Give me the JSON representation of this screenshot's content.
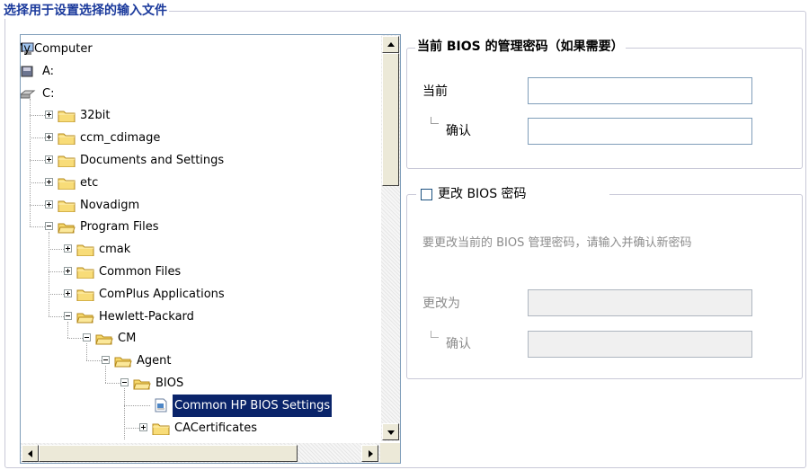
{
  "outer_group": {
    "title": "选择用于设置选择的输入文件"
  },
  "tree": {
    "items": [
      {
        "label": "My Computer",
        "icon": "computer-icon"
      },
      {
        "label": "A:",
        "icon": "floppy-drive-icon"
      },
      {
        "label": "C:",
        "icon": "hard-drive-icon"
      },
      {
        "label": "32bit",
        "icon": "folder-icon",
        "expander": "plus"
      },
      {
        "label": "ccm_cdimage",
        "icon": "folder-icon",
        "expander": "plus"
      },
      {
        "label": "Documents and Settings",
        "icon": "folder-icon",
        "expander": "plus"
      },
      {
        "label": "etc",
        "icon": "folder-icon",
        "expander": "plus"
      },
      {
        "label": "Novadigm",
        "icon": "folder-icon",
        "expander": "plus"
      },
      {
        "label": "Program Files",
        "icon": "folder-open-icon",
        "expander": "minus"
      },
      {
        "label": "cmak",
        "icon": "folder-icon",
        "expander": "plus"
      },
      {
        "label": "Common Files",
        "icon": "folder-icon",
        "expander": "plus"
      },
      {
        "label": "ComPlus Applications",
        "icon": "folder-icon",
        "expander": "plus"
      },
      {
        "label": "Hewlett-Packard",
        "icon": "folder-open-icon",
        "expander": "minus"
      },
      {
        "label": "CM",
        "icon": "folder-open-icon",
        "expander": "minus"
      },
      {
        "label": "Agent",
        "icon": "folder-open-icon",
        "expander": "minus"
      },
      {
        "label": "BIOS",
        "icon": "folder-open-icon",
        "expander": "minus"
      },
      {
        "label": "Common HP BIOS Settings",
        "icon": "settings-file-icon",
        "selected": true
      },
      {
        "label": "CACertificates",
        "icon": "folder-icon",
        "expander": "plus"
      }
    ]
  },
  "current_password": {
    "title": "当前 BIOS 的管理密码（如果需要）",
    "current_label": "当前",
    "confirm_label": "确认",
    "current_value": "",
    "confirm_value": ""
  },
  "change_password": {
    "checkbox_label": "更改 BIOS 密码",
    "checked": false,
    "description": "要更改当前的 BIOS 管理密码，请输入并确认新密码",
    "new_label": "更改为",
    "confirm_label": "确认",
    "new_value": "",
    "confirm_value": ""
  }
}
